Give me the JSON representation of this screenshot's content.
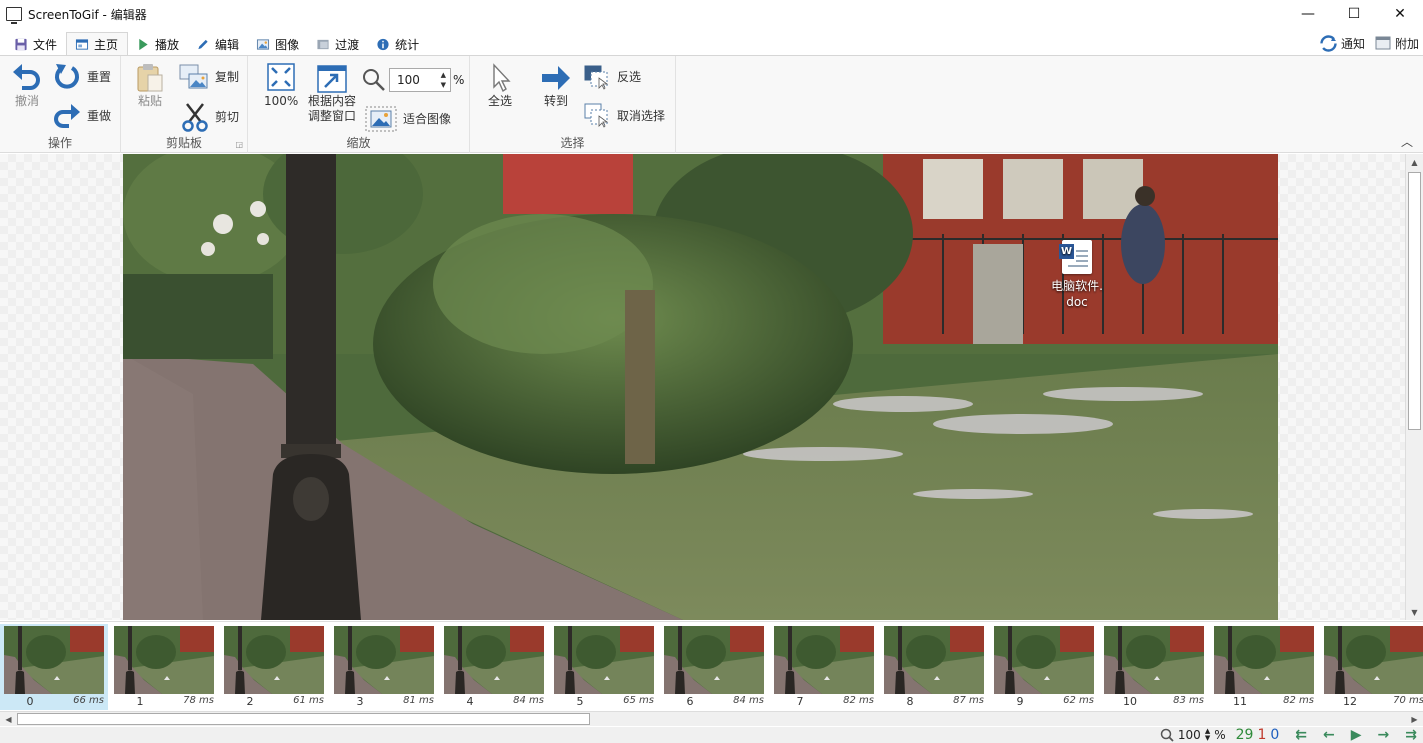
{
  "window": {
    "title": "ScreenToGif - 编辑器",
    "controls": {
      "minimize": "—",
      "maximize": "☐",
      "close": "✕"
    }
  },
  "tabs": [
    {
      "label": "文件",
      "icon": "save-icon"
    },
    {
      "label": "主页",
      "icon": "home-icon",
      "active": true
    },
    {
      "label": "播放",
      "icon": "play-icon"
    },
    {
      "label": "编辑",
      "icon": "pencil-icon"
    },
    {
      "label": "图像",
      "icon": "image-icon"
    },
    {
      "label": "过渡",
      "icon": "transition-icon"
    },
    {
      "label": "统计",
      "icon": "info-icon"
    }
  ],
  "tabbar_right": {
    "notify": "通知",
    "extras": "附加"
  },
  "ribbon": {
    "actions": {
      "group": "操作",
      "undo": "撤消",
      "reset": "重置",
      "redo": "重做"
    },
    "clipboard": {
      "group": "剪贴板",
      "paste": "粘贴",
      "copy": "复制",
      "cut": "剪切"
    },
    "zoom": {
      "group": "缩放",
      "zoom100": "100%",
      "fit_content_1": "根据内容",
      "fit_content_2": "调整窗口",
      "fit_image": "适合图像",
      "value": "100",
      "unit": "%"
    },
    "select": {
      "group": "选择",
      "select_all": "全选",
      "goto": "转到",
      "invert": "反选",
      "deselect": "取消选择"
    }
  },
  "desktop_icon": {
    "name_1": "电脑软件.",
    "name_2": "doc"
  },
  "frames": [
    {
      "index": "0",
      "delay": "66 ms"
    },
    {
      "index": "1",
      "delay": "78 ms"
    },
    {
      "index": "2",
      "delay": "61 ms"
    },
    {
      "index": "3",
      "delay": "81 ms"
    },
    {
      "index": "4",
      "delay": "84 ms"
    },
    {
      "index": "5",
      "delay": "65 ms"
    },
    {
      "index": "6",
      "delay": "84 ms"
    },
    {
      "index": "7",
      "delay": "82 ms"
    },
    {
      "index": "8",
      "delay": "87 ms"
    },
    {
      "index": "9",
      "delay": "62 ms"
    },
    {
      "index": "10",
      "delay": "83 ms"
    },
    {
      "index": "11",
      "delay": "82 ms"
    },
    {
      "index": "12",
      "delay": "70 ms"
    }
  ],
  "status": {
    "zoom": "100",
    "zoom_unit": "%",
    "frame_count": "29",
    "selected_count": "1",
    "current_frame": "0",
    "colors": {
      "count": "#2e8b3a",
      "selected": "#c0392b",
      "current": "#1f5fbf"
    }
  },
  "colors": {
    "accent_blue": "#1e6fc3",
    "nav_green": "#3a8a5c",
    "selected_thumb": "#cce8f6"
  }
}
